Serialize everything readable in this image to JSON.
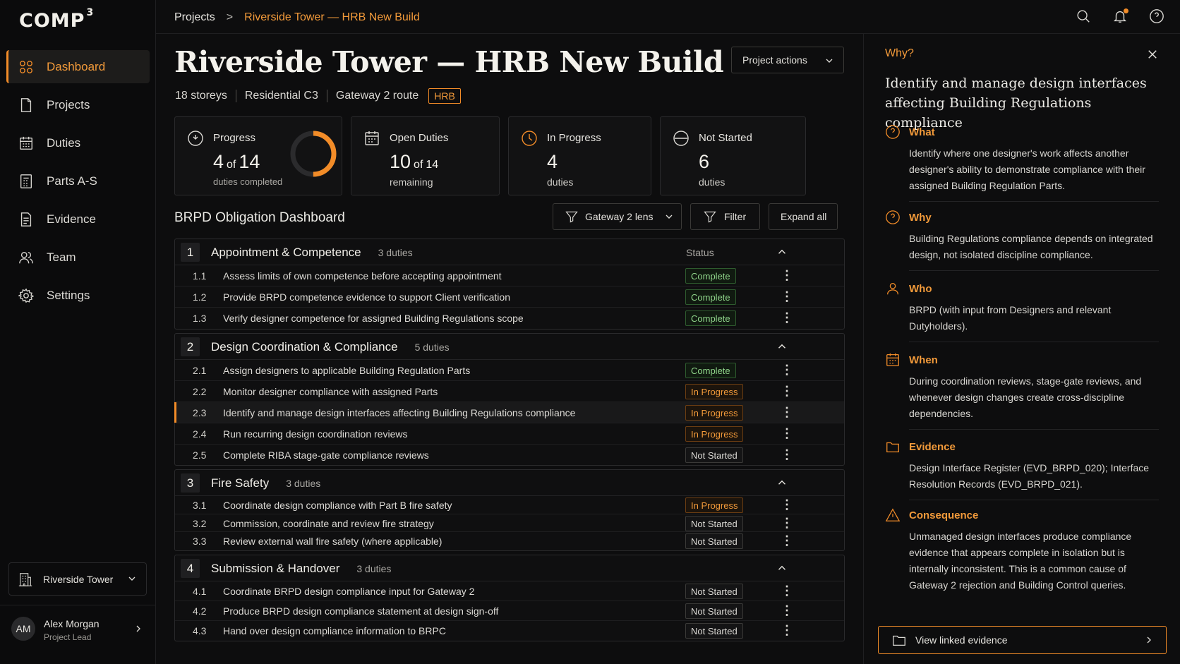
{
  "brand": {
    "name": "COMP",
    "sup": "3"
  },
  "nav": [
    {
      "label": "Dashboard",
      "icon": "dashboard-icon",
      "active": true
    },
    {
      "label": "Projects",
      "icon": "projects-icon"
    },
    {
      "label": "Duties",
      "icon": "duties-icon"
    },
    {
      "label": "Parts A-S",
      "icon": "parts-icon"
    },
    {
      "label": "Evidence",
      "icon": "evidence-icon"
    },
    {
      "label": "Team",
      "icon": "team-icon"
    },
    {
      "label": "Settings",
      "icon": "gear-icon"
    }
  ],
  "project_switch": "Riverside Tower",
  "user": {
    "initials": "AM",
    "name": "Alex Morgan",
    "role": "Project Lead"
  },
  "breadcrumb": {
    "root": "Projects",
    "sep": ">",
    "current": "Riverside Tower — HRB New Build"
  },
  "page": {
    "title": "Riverside Tower — HRB New Build",
    "meta": [
      "18 storeys",
      "Residential C3",
      "Gateway 2 route"
    ],
    "tag": "HRB",
    "actions": "Project actions"
  },
  "stats": {
    "progress": {
      "label": "Progress",
      "value": "4",
      "of": "of",
      "total": "14",
      "sub": "duties completed",
      "fraction": 0.2857
    },
    "open": {
      "label": "Open Duties",
      "value": "10",
      "of": "of",
      "total": "14",
      "sub": "remaining"
    },
    "inprogress": {
      "label": "In Progress",
      "value": "4",
      "sub": "duties"
    },
    "notstarted": {
      "label": "Not Started",
      "value": "6",
      "sub": "duties"
    }
  },
  "dashboard": {
    "title": "BRPD Obligation Dashboard",
    "lens": "Gateway 2 lens",
    "filter": "Filter",
    "expand": "Expand all",
    "status_header": "Status"
  },
  "groups": [
    {
      "num": "1",
      "name": "Appointment & Competence",
      "count": "3 duties",
      "rows": [
        {
          "num": "1.1",
          "text": "Assess limits of own competence before accepting appointment",
          "status": "Complete"
        },
        {
          "num": "1.2",
          "text": "Provide BRPD competence evidence to support Client verification",
          "status": "Complete"
        },
        {
          "num": "1.3",
          "text": "Verify designer competence for assigned Building Regulations scope",
          "status": "Complete"
        }
      ]
    },
    {
      "num": "2",
      "name": "Design Coordination & Compliance",
      "count": "5 duties",
      "rows": [
        {
          "num": "2.1",
          "text": "Assign designers to applicable Building Regulation Parts",
          "status": "Complete"
        },
        {
          "num": "2.2",
          "text": "Monitor designer compliance with assigned Parts",
          "status": "In Progress"
        },
        {
          "num": "2.3",
          "text": "Identify and manage design interfaces affecting Building Regulations compliance",
          "status": "In Progress",
          "selected": true
        },
        {
          "num": "2.4",
          "text": "Run recurring design coordination reviews",
          "status": "In Progress"
        },
        {
          "num": "2.5",
          "text": "Complete RIBA stage-gate compliance reviews",
          "status": "Not Started"
        }
      ]
    },
    {
      "num": "3",
      "name": "Fire Safety",
      "count": "3 duties",
      "rows": [
        {
          "num": "3.1",
          "text": "Coordinate design compliance with Part B fire safety",
          "status": "In Progress"
        },
        {
          "num": "3.2",
          "text": "Commission, coordinate and review fire strategy",
          "status": "Not Started"
        },
        {
          "num": "3.3",
          "text": "Review external wall fire safety (where applicable)",
          "status": "Not Started"
        }
      ]
    },
    {
      "num": "4",
      "name": "Submission & Handover",
      "count": "3 duties",
      "rows": [
        {
          "num": "4.1",
          "text": "Coordinate BRPD design compliance input for Gateway 2",
          "status": "Not Started"
        },
        {
          "num": "4.2",
          "text": "Produce BRPD design compliance statement at design sign-off",
          "status": "Not Started"
        },
        {
          "num": "4.3",
          "text": "Hand over design compliance information to BRPC",
          "status": "Not Started"
        }
      ]
    }
  ],
  "panel": {
    "heading": "Why?",
    "title": "Identify and manage design interfaces affecting Building Regulations compliance",
    "sections": [
      {
        "label": "What",
        "icon": "question-circle-icon",
        "body": "Identify where one designer's work affects another designer's ability to demonstrate compliance with their assigned Building Regulation Parts."
      },
      {
        "label": "Why",
        "icon": "question-circle-icon",
        "body": "Building Regulations compliance depends on integrated design, not isolated discipline compliance."
      },
      {
        "label": "Who",
        "icon": "person-icon",
        "body": "BRPD (with input from Designers and relevant Dutyholders)."
      },
      {
        "label": "When",
        "icon": "calendar-icon",
        "body": "During coordination reviews, stage-gate reviews, and whenever design changes create cross-discipline dependencies."
      },
      {
        "label": "Evidence",
        "icon": "folder-icon",
        "body": "Design Interface Register (EVD_BRPD_020); Interface Resolution Records (EVD_BRPD_021)."
      },
      {
        "label": "Consequence",
        "icon": "warning-icon",
        "body": "Unmanaged design interfaces produce compliance evidence that appears complete in isolation but is internally inconsistent. This is a common cause of Gateway 2 rejection and Building Control queries."
      }
    ],
    "cta": "View linked evidence"
  },
  "colors": {
    "accent": "#f28c28",
    "complete": "#8fd48a",
    "background": "#0d0d0e"
  }
}
